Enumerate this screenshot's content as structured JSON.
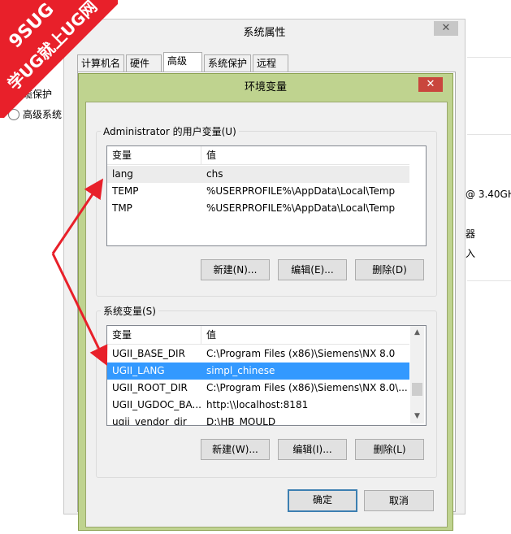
{
  "watermark": {
    "line1": "9SUG",
    "line2": "学UG就上UG网",
    "color": "#e8202a"
  },
  "background": {
    "bg_cpu_text": "@ 3.40GH",
    "bg_text2": "器",
    "bg_text3": "入",
    "bg_radio_item1": "缆保护",
    "bg_radio_item2": "高级系统"
  },
  "sysprops": {
    "title": "系统属性",
    "close": "✕",
    "tabs": [
      "计算机名",
      "硬件",
      "高级",
      "系统保护",
      "远程"
    ],
    "active_tab": "高级"
  },
  "envvars": {
    "title": "环境变量",
    "close": "✕",
    "user_group": {
      "label": "Administrator 的用户变量(U)",
      "col_var": "变量",
      "col_value": "值",
      "rows": [
        {
          "var": "lang",
          "value": "chs"
        },
        {
          "var": "TEMP",
          "value": "%USERPROFILE%\\AppData\\Local\\Temp"
        },
        {
          "var": "TMP",
          "value": "%USERPROFILE%\\AppData\\Local\\Temp"
        }
      ],
      "new_button": "新建(N)...",
      "edit_button": "编辑(E)...",
      "delete_button": "删除(D)"
    },
    "system_group": {
      "label": "系统变量(S)",
      "col_var": "变量",
      "col_value": "值",
      "rows": [
        {
          "var": "UGII_BASE_DIR",
          "value": "C:\\Program Files (x86)\\Siemens\\NX 8.0"
        },
        {
          "var": "UGII_LANG",
          "value": "simpl_chinese"
        },
        {
          "var": "UGII_ROOT_DIR",
          "value": "C:\\Program Files (x86)\\Siemens\\NX 8.0\\..."
        },
        {
          "var": "UGII_UGDOC_BA...",
          "value": "http:\\\\localhost:8181"
        },
        {
          "var": "ugii_vendor_dir",
          "value": "D:\\HB_MOULD"
        }
      ],
      "selected_var": "UGII_LANG",
      "new_button": "新建(W)...",
      "edit_button": "编辑(I)...",
      "delete_button": "删除(L)"
    },
    "ok_button": "确定",
    "cancel_button": "取消"
  },
  "colors": {
    "selection": "#3399ff",
    "env_frame": "#bfd38f",
    "close_red": "#c9463d",
    "arrow_red": "#e8202a"
  }
}
